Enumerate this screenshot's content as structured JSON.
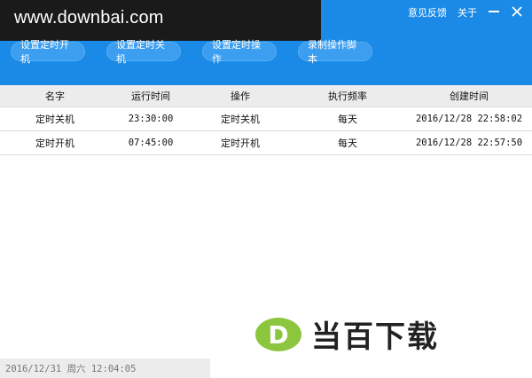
{
  "header": {
    "watermark": "www.downbai.com",
    "links": [
      "意见反馈",
      "关于"
    ]
  },
  "toolbar": {
    "buttons": [
      "设置定时开机",
      "设置定时关机",
      "设置定时操作",
      "录制操作脚本"
    ]
  },
  "table": {
    "columns": [
      "名字",
      "运行时间",
      "操作",
      "执行频率",
      "创建时间"
    ],
    "rows": [
      [
        "定时关机",
        "23:30:00",
        "定时关机",
        "每天",
        "2016/12/28 22:58:02"
      ],
      [
        "定时开机",
        "07:45:00",
        "定时开机",
        "每天",
        "2016/12/28 22:57:50"
      ]
    ]
  },
  "status": {
    "text": "2016/12/31 周六 12:04:05"
  },
  "logo": {
    "letter": "D",
    "text": "当百下载"
  },
  "colors": {
    "header": "#1b8ae6",
    "logo_green": "#8cc63f"
  }
}
